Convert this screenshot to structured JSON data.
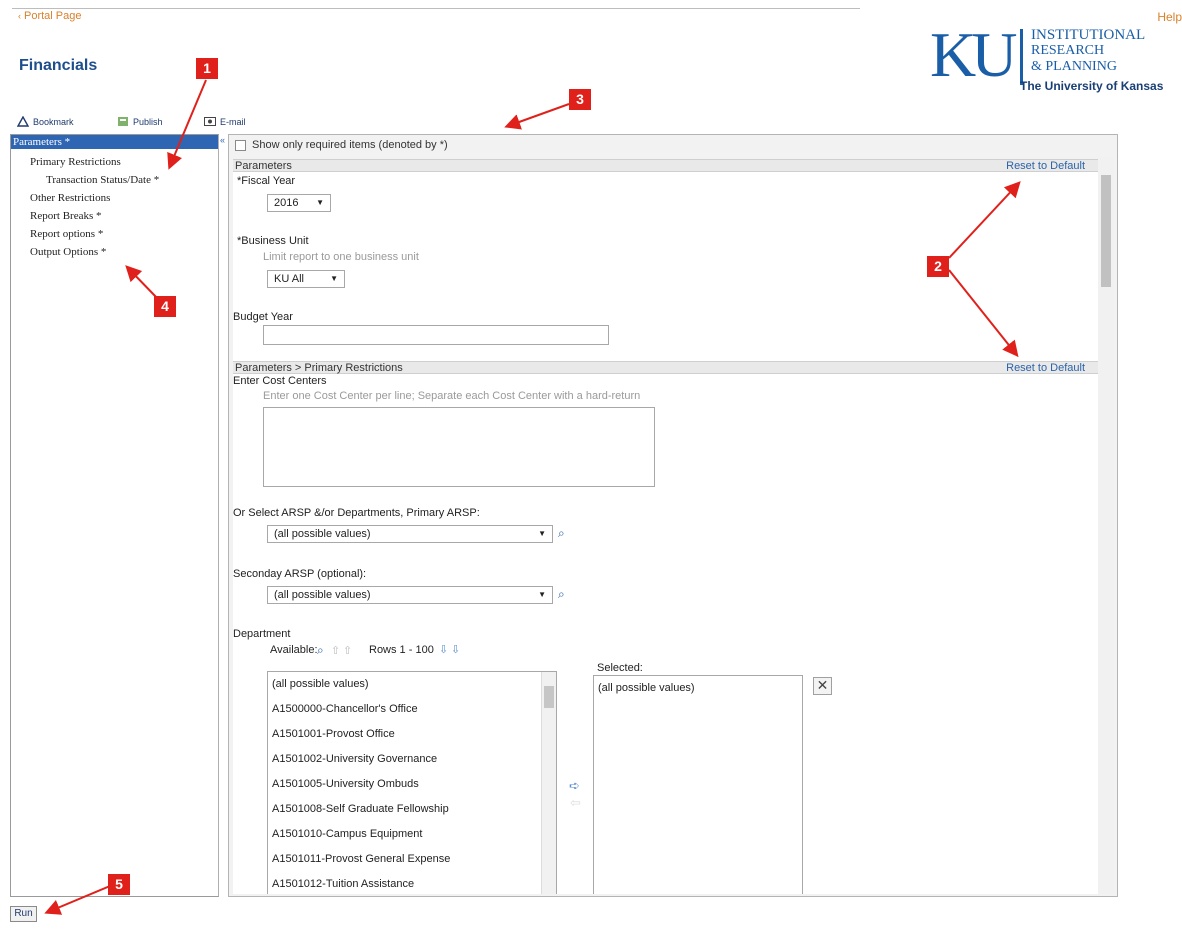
{
  "top": {
    "portal_link": "Portal Page",
    "help_link": "Help",
    "page_title": "Financials"
  },
  "logo": {
    "mark": "KU",
    "line1": "INSTITUTIONAL",
    "line2": "RESEARCH",
    "line3": "& PLANNING",
    "university": "The University of Kansas"
  },
  "toolbar": {
    "bookmark": "Bookmark",
    "publish": "Publish",
    "email": "E-mail"
  },
  "nav": {
    "selected": "Parameters *",
    "items": [
      "Primary Restrictions",
      "Transaction Status/Date *",
      "Other Restrictions",
      "Report Breaks *",
      "Report options *",
      "Output Options *"
    ]
  },
  "content": {
    "show_required": "Show only required items (denoted by *)",
    "section1": {
      "title": "Parameters",
      "reset": "Reset to Default"
    },
    "fiscal_year": {
      "label": "*Fiscal Year",
      "value": "2016"
    },
    "business_unit": {
      "label": "*Business Unit",
      "hint": "Limit report to one business unit",
      "value": "KU All"
    },
    "budget_year": {
      "label": "Budget Year",
      "value": ""
    },
    "section2": {
      "title": "Parameters > Primary Restrictions",
      "reset": "Reset to Default"
    },
    "cost_centers": {
      "label": "Enter Cost Centers",
      "hint": "Enter one Cost Center per line; Separate each Cost Center with a hard-return"
    },
    "primary_arsp": {
      "label": "Or Select ARSP &/or Departments, Primary ARSP:",
      "value": "(all possible values)"
    },
    "secondary_arsp": {
      "label": "Seconday ARSP (optional):",
      "value": "(all possible values)"
    },
    "department": {
      "label": "Department",
      "available_label": "Available:",
      "rows_label": "Rows 1 - 100",
      "selected_label": "Selected:",
      "available_items": [
        "(all possible values)",
        "A1500000-Chancellor's Office",
        "A1501001-Provost Office",
        "A1501002-University Governance",
        "A1501005-University Ombuds",
        "A1501008-Self Graduate Fellowship",
        "A1501010-Campus Equipment",
        "A1501011-Provost General Expense",
        "A1501012-Tuition Assistance"
      ],
      "selected_items": [
        "(all possible values)"
      ]
    }
  },
  "run_button": "Run",
  "annotations": [
    "1",
    "2",
    "3",
    "4",
    "5"
  ],
  "colors": {
    "title_blue": "#1f4e8c",
    "nav_selected": "#2f66b3",
    "link_orange": "#d9822b",
    "annotation_red": "#e0211b",
    "logo_blue": "#1a5ea8"
  }
}
